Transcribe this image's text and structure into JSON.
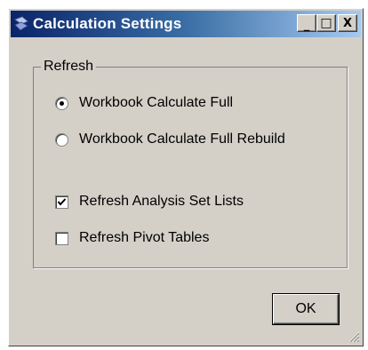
{
  "window": {
    "title": "Calculation Settings",
    "app_icon": "dialog-icon",
    "controls": {
      "minimize": "_",
      "maximize": "□",
      "close": "X"
    }
  },
  "refresh_group": {
    "label": "Refresh",
    "radio_options": [
      {
        "label": "Workbook Calculate Full",
        "selected": true
      },
      {
        "label": "Workbook Calculate Full Rebuild",
        "selected": false
      }
    ],
    "checkboxes": [
      {
        "label": "Refresh Analysis Set Lists",
        "checked": true
      },
      {
        "label": "Refresh Pivot Tables",
        "checked": false
      }
    ]
  },
  "buttons": {
    "ok": "OK"
  },
  "colors": {
    "title_gradient_start": "#0a246a",
    "title_gradient_end": "#a6caf0",
    "face": "#d4d0c8"
  }
}
